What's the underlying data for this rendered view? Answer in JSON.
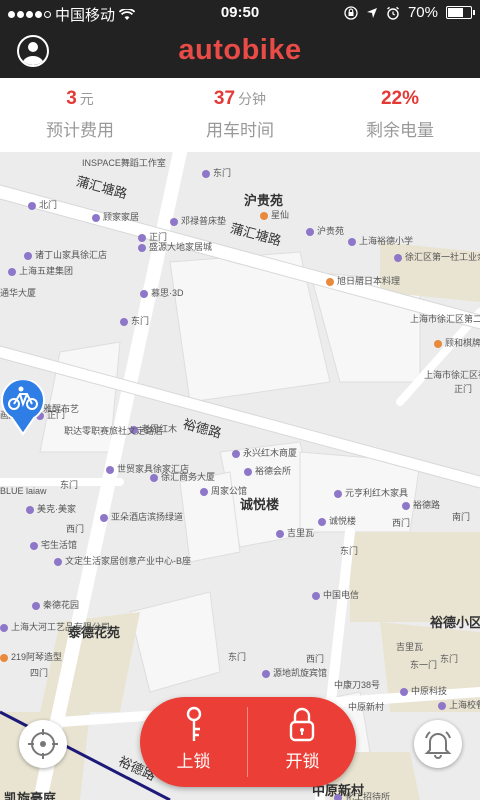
{
  "status_bar": {
    "carrier": "中国移动",
    "time": "09:50",
    "battery": "70%",
    "battery_level": 0.7
  },
  "header": {
    "app_title": "autobike",
    "avatar_icon": "user-avatar-icon"
  },
  "stats": [
    {
      "value": "3",
      "unit": "元",
      "label": "预计费用"
    },
    {
      "value": "37",
      "unit": "分钟",
      "label": "用车时间"
    },
    {
      "value": "22%",
      "unit": "",
      "label": "剩余电量"
    }
  ],
  "map": {
    "roads": [
      "蒲汇塘路",
      "蒲汇塘路",
      "裕德路",
      "裕德路"
    ],
    "areas": [
      "沪贵苑",
      "诚悦楼",
      "泰德花苑",
      "裕德小区",
      "中原新村",
      "凯旋豪庭"
    ],
    "pois": [
      "INSPACE舞蹈工作室",
      "北门",
      "顾家家居",
      "邓禄普床垫",
      "东门",
      "星仙",
      "沪贵苑",
      "正门",
      "上海裕德小学",
      "盛源大地家居城",
      "徐汇区第一社工业余中学",
      "诸丁山家具徐汇店",
      "上海五建集团",
      "上海市徐汇区第二社区",
      "慕思·3D",
      "旭日腊日本料理",
      "通华大厦",
      "东门",
      "顾和棋牌",
      "上海市徐汇区社区",
      "正门",
      "正门",
      "西门",
      "雅醒布艺",
      "画家街",
      "老周红木",
      "职达零职赛旅社文定路店",
      "永兴红木商厦",
      "裕德会所",
      "东门",
      "世贸家具徐家汇店",
      "徐汇商务大厦",
      "周家公馆",
      "元亨利红木家具",
      "裕德路",
      "南门",
      "BLUE laiaw",
      "美克·美家",
      "诚悦楼",
      "西门",
      "西门",
      "吉里瓦",
      "亚朵酒店滨扬绿道",
      "宅生活馆",
      "文定生活家居创意产业中心-B座",
      "东门",
      "中国电信",
      "秦德花园",
      "上海大河工艺品有限公司",
      "219阿琴造型",
      "东门",
      "源地凯旋宾馆",
      "中康刀38号",
      "中原科技",
      "四门",
      "西门",
      "吉里瓦",
      "东门",
      "东一门",
      "中原新村",
      "化工招待所",
      "上海校餐具有限公司"
    ]
  },
  "actions": {
    "lock_label": "上锁",
    "unlock_label": "开锁"
  },
  "colors": {
    "accent": "#ea3e36",
    "header_bg": "#222222",
    "bike_pin": "#2f7ee6"
  }
}
